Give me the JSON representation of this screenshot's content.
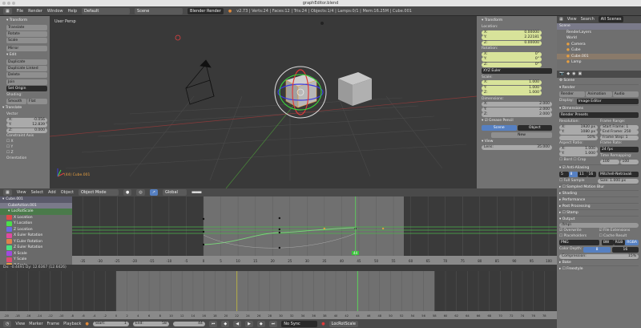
{
  "window": {
    "title": "graphEditor.blend"
  },
  "info_header": {
    "menus": [
      "File",
      "Render",
      "Window",
      "Help"
    ],
    "layout": "Default",
    "scene": "Scene",
    "engine": "Blender Render",
    "stats": "v2.73 | Verts:24 | Faces:12 | Tris:24 | Objects:1/4 | Lamps:0/1 | Mem:16.25M | Cube.001"
  },
  "toolshelf": {
    "transform_title": "Transform",
    "transform_buttons": [
      "Translate",
      "Rotate",
      "Scale",
      "Mirror"
    ],
    "edit_title": "Edit",
    "edit_buttons": [
      "Duplicate",
      "Duplicate Linked",
      "Delete",
      "Join"
    ],
    "set_origin": "Set Origin",
    "shading_label": "Shading:",
    "shading_buttons": [
      "Smooth",
      "Flat"
    ],
    "operator_title": "Translate",
    "vector_label": "Vector",
    "vector": [
      {
        "axis": "X:",
        "value": "-0.056"
      },
      {
        "axis": "Y:",
        "value": "12.839"
      },
      {
        "axis": "Z:",
        "value": "0.000"
      }
    ],
    "constraint_label": "Constraint Axis",
    "constraints": [
      "X",
      "Y",
      "Z"
    ],
    "orientation_label": "Orientation"
  },
  "viewport": {
    "label": "User Persp",
    "object_label": "(44) Cube.001"
  },
  "npanel": {
    "title": "Transform",
    "location_label": "Location:",
    "location": [
      {
        "axis": "X:",
        "value": "0.00000"
      },
      {
        "axis": "Y:",
        "value": "2.22181"
      },
      {
        "axis": "Z:",
        "value": "0.00000"
      }
    ],
    "rotation_label": "Rotation:",
    "rotation": [
      {
        "axis": "X:",
        "value": "0°"
      },
      {
        "axis": "Y:",
        "value": "0°"
      },
      {
        "axis": "Z:",
        "value": "0°"
      }
    ],
    "rotation_mode": "XYZ Euler",
    "scale_label": "Scale:",
    "scale": [
      {
        "axis": "X:",
        "value": "1.000"
      },
      {
        "axis": "Y:",
        "value": "1.000"
      },
      {
        "axis": "Z:",
        "value": "1.000"
      }
    ],
    "dimensions_label": "Dimensions:",
    "dimensions": [
      {
        "axis": "X:",
        "value": "2.000"
      },
      {
        "axis": "Y:",
        "value": "2.000"
      },
      {
        "axis": "Z:",
        "value": "2.000"
      }
    ],
    "grease_pencil": "Grease Pencil",
    "gp_tabs": [
      "Scene",
      "Object"
    ],
    "gp_new": "New",
    "view_title": "View",
    "lens_label": "Lens:",
    "lens_value": "35.000"
  },
  "outliner": {
    "tabs": [
      "View",
      "Search",
      "All Scenes"
    ],
    "items": [
      "Scene",
      "RenderLayers",
      "World",
      "Camera",
      "Cube",
      "Cube.001",
      "Lamp"
    ]
  },
  "properties": {
    "context": "Scene",
    "render_title": "Render",
    "render_buttons": [
      "Render",
      "Animation",
      "Audio"
    ],
    "display_label": "Display:",
    "display_value": "Image Editor",
    "dimensions_title": "Dimensions",
    "presets": "Render Presets",
    "resolution_label": "Resolution:",
    "res_x": "1920 px",
    "res_y": "1080 px",
    "res_pct": "50%",
    "frame_range_label": "Frame Range:",
    "start_frame": "Start Frame: 1",
    "end_frame": "End Frame: 250",
    "frame_step": "Frame Step: 1",
    "aspect_label": "Aspect Ratio:",
    "aspect_x": "1.000",
    "aspect_y": "1.000",
    "frame_rate_label": "Frame Rate:",
    "frame_rate": "24 fps",
    "time_remap_label": "Time Remapping:",
    "remap_old": "100",
    "remap_new": "100",
    "border": "Bord",
    "crop": "Crop",
    "aa_title": "Anti-Aliasing",
    "aa_samples": [
      "5",
      "8",
      "11",
      "16"
    ],
    "aa_filter": "Mitchell-Netravali",
    "full_sample": "Full Sample",
    "aa_size": "Size: 1.000 px",
    "panels": [
      "Sampled Motion Blur",
      "Shading",
      "Performance",
      "Post Processing",
      "Stamp"
    ],
    "output_title": "Output",
    "output_path": "/tmp\\",
    "overwrite": "Overwrite",
    "file_ext": "File Extensions",
    "placeholders": "Placeholders",
    "cache": "Cache Result",
    "format": "PNG",
    "color_modes": [
      "BW",
      "RGB",
      "RGBA"
    ],
    "color_depth_label": "Color Depth:",
    "depths": [
      "8",
      "16"
    ],
    "compression_label": "Compression:",
    "compression": "15%",
    "bake": "Bake",
    "freestyle": "Freestyle"
  },
  "graph_header": {
    "menus": [
      "View",
      "Select",
      "Add",
      "Object"
    ],
    "mode": "Object Mode",
    "orientation": "Global"
  },
  "channels": {
    "object": "Cube.001",
    "action": "CubeAction.001",
    "group": "LocRotScale",
    "curves": [
      {
        "name": "X Location",
        "color": "#e04a4a"
      },
      {
        "name": "Y Location",
        "color": "#4ae04a"
      },
      {
        "name": "Z Location",
        "color": "#6a6ae0"
      },
      {
        "name": "X Euler Rotation",
        "color": "#e04aa0"
      },
      {
        "name": "Y Euler Rotation",
        "color": "#e0804a"
      },
      {
        "name": "Z Euler Rotation",
        "color": "#4ae080"
      },
      {
        "name": "X Scale",
        "color": "#a04ae0"
      },
      {
        "name": "Y Scale",
        "color": "#e04a70"
      },
      {
        "name": "Z Scale",
        "color": "#e0a04a"
      }
    ]
  },
  "graph": {
    "current_frame": "44",
    "x_ticks": [
      -35,
      -30,
      -25,
      -20,
      -15,
      -10,
      -5,
      0,
      5,
      10,
      15,
      20,
      25,
      30,
      35,
      40,
      45,
      50,
      55,
      60,
      65,
      70,
      75,
      80,
      85,
      90,
      95,
      100
    ],
    "status": "Dx: -0.4491  Dy: 12.6367 (12.6426)"
  },
  "timeline": {
    "x_ticks": [
      -20,
      -18,
      -16,
      -14,
      -12,
      -10,
      -8,
      -6,
      -4,
      -2,
      0,
      2,
      4,
      6,
      8,
      10,
      12,
      14,
      16,
      18,
      20,
      22,
      24,
      26,
      28,
      30,
      32,
      34,
      36,
      38,
      40,
      42,
      44,
      46,
      48,
      50,
      52,
      54,
      56,
      58,
      60,
      62,
      64,
      66,
      68,
      70,
      72,
      74,
      76,
      78
    ],
    "menus": [
      "View",
      "Marker",
      "Frame",
      "Playback"
    ],
    "start": "Start:",
    "start_value": "1",
    "end": "End:",
    "end_value": "58",
    "current": "44",
    "sync": "No Sync",
    "keying_set": "LocRotScale"
  },
  "colors": {
    "accent": "#5680c2",
    "keyframe_line": "#5ec45e",
    "selected_field": "#d8e39a"
  }
}
